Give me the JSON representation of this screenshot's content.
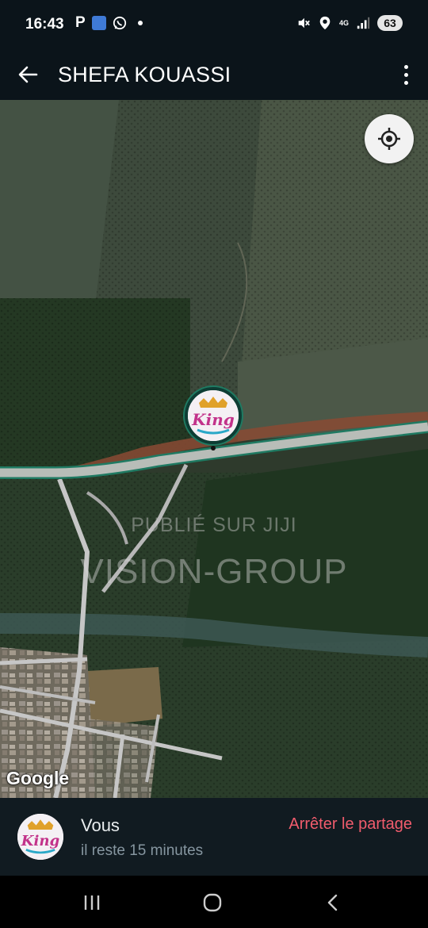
{
  "status_bar": {
    "time": "16:43",
    "p_indicator": "P",
    "app_icon": "news-app-icon",
    "whatsapp_icon": "whatsapp-icon",
    "mute_icon": "mute-icon",
    "location_icon": "location-icon",
    "network": "4G",
    "signal_icon": "signal-icon",
    "battery": "63"
  },
  "header": {
    "back_icon": "arrow-left-icon",
    "title": "SHEFA KOUASSI",
    "menu_icon": "more-vertical-icon"
  },
  "map": {
    "locate_icon": "my-location-icon",
    "avatar_text": "King",
    "watermark_line1": "PUBLIÉ SUR JIJI",
    "watermark_line2": "VISION-GROUP",
    "google_logo": "Google"
  },
  "share": {
    "name": "Vous",
    "remaining": "il reste 15 minutes",
    "stop_label": "Arrêter le partage",
    "avatar_text": "King"
  },
  "nav": {
    "recents_icon": "recents-icon",
    "home_icon": "home-circle-icon",
    "back_icon": "nav-back-icon"
  },
  "colors": {
    "background": "#0b141a",
    "stop_share": "#f15c6d",
    "route": "#1f7a62"
  }
}
